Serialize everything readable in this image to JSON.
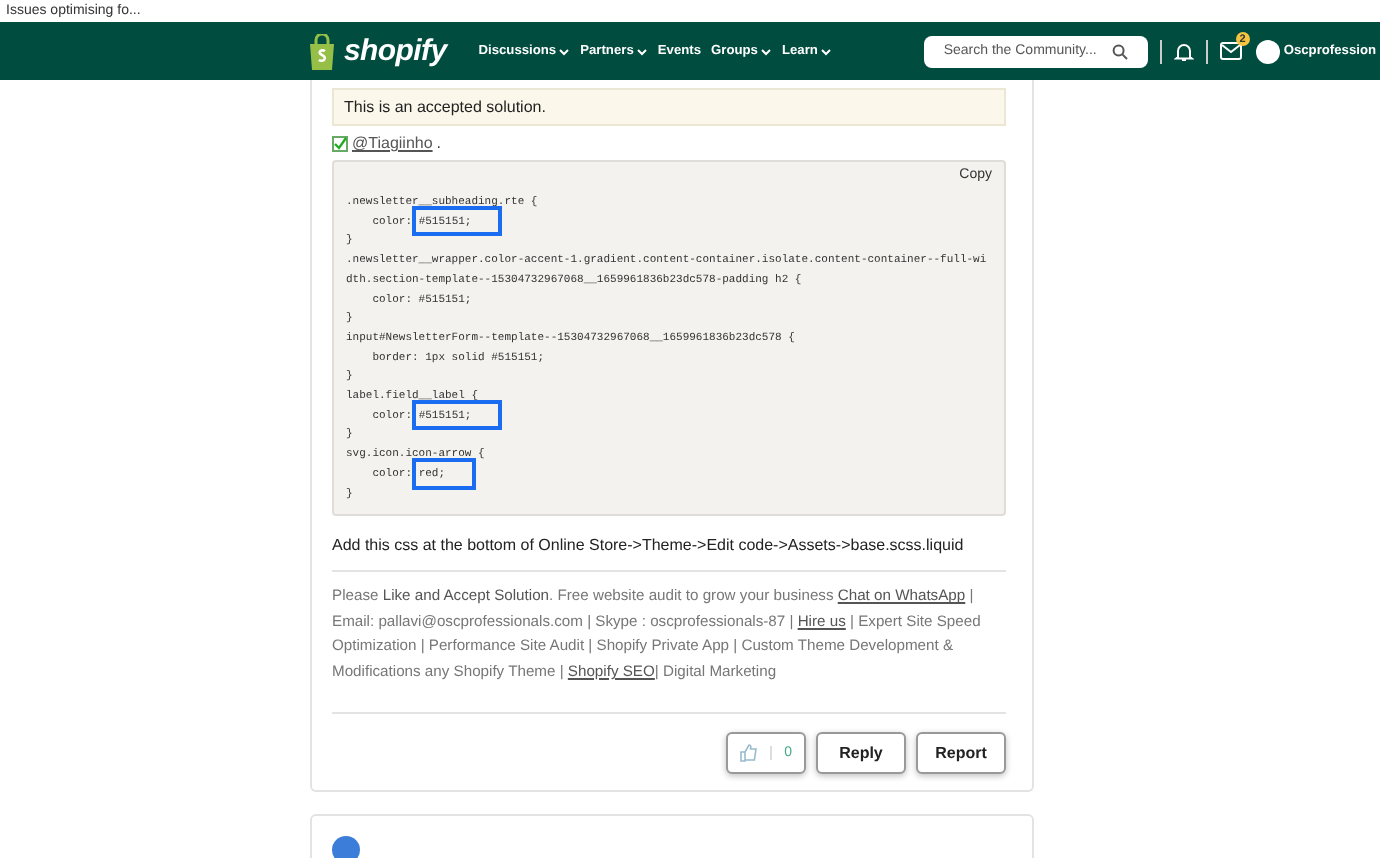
{
  "tab_title": "Issues optimising fo...",
  "header": {
    "logo": "shopify",
    "nav": [
      {
        "label": "Discussions",
        "dropdown": true
      },
      {
        "label": "Partners",
        "dropdown": true
      },
      {
        "label": "Events",
        "dropdown": false
      },
      {
        "label": "Groups",
        "dropdown": true
      },
      {
        "label": "Learn",
        "dropdown": true
      }
    ],
    "search": {
      "placeholder": "Search the Community..."
    },
    "mail_badge": "2",
    "user": "Oscprofession"
  },
  "post": {
    "accepted_banner": "This is an accepted solution.",
    "mention": "@Tiagiinho",
    "mention_suffix": " .",
    "copy": "Copy",
    "code": [
      {
        "text": ".newsletter__subheading.rte {"
      },
      {
        "text": "    color: ",
        "marked": "#515151;"
      },
      {
        "text": "}"
      },
      {
        "text": ".newsletter__wrapper.color-accent-1.gradient.content-container.isolate.content-container--full-width.section-template--15304732967068__1659961836b23dc578-padding h2 {"
      },
      {
        "text": "    color: #515151;"
      },
      {
        "text": "}"
      },
      {
        "text": "input#NewsletterForm--template--15304732967068__1659961836b23dc578 {"
      },
      {
        "text": "    border: 1px solid #515151;"
      },
      {
        "text": "}"
      },
      {
        "text": "label.field__label {"
      },
      {
        "text": "    color: ",
        "marked": "#515151;"
      },
      {
        "text": "}"
      },
      {
        "text": "svg.icon.icon-arrow {"
      },
      {
        "text": "    color: ",
        "marked": "red;"
      },
      {
        "text": "}"
      }
    ],
    "instruction": "Add this css at the bottom of Online Store->Theme->Edit code->Assets->base.scss.liquid",
    "signature": [
      {
        "kind": "text",
        "text": "Please "
      },
      {
        "kind": "bold",
        "text": "Like and Accept Solution"
      },
      {
        "kind": "text",
        "text": ". Free website audit to grow your business "
      },
      {
        "kind": "link",
        "text": "Chat on WhatsApp"
      },
      {
        "kind": "text",
        "text": " | Email: pallavi@oscprofessionals.com | Skype : oscprofessionals-87 | "
      },
      {
        "kind": "link",
        "text": "Hire us"
      },
      {
        "kind": "text",
        "text": " | Expert Site Speed Optimization | Performance Site Audit | Shopify Private App | Custom Theme Development & Modifications any Shopify Theme | "
      },
      {
        "kind": "link",
        "text": "Shopify SEO"
      },
      {
        "kind": "text",
        "text": "| Digital Marketing"
      }
    ],
    "likes": "0",
    "buttons": [
      "Reply",
      "Report"
    ]
  }
}
